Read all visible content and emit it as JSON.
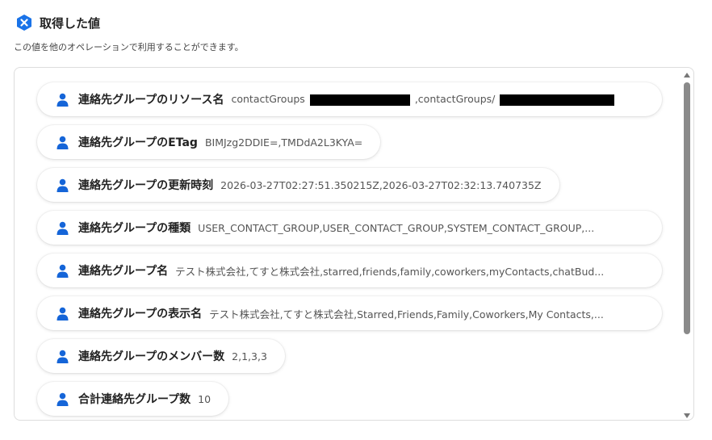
{
  "header": {
    "title": "取得した値",
    "subtitle": "この値を他のオペレーションで利用することができます。"
  },
  "colors": {
    "accent": "#1a73e8",
    "user_icon": "#1565d8"
  },
  "items": [
    {
      "label": "連絡先グループのリソース名",
      "value_pre": "contactGroups",
      "value_mid": ",contactGroups/",
      "redacted": true
    },
    {
      "label": "連絡先グループのETag",
      "value": "BIMJzg2DDIE=,TMDdA2L3KYA="
    },
    {
      "label": "連絡先グループの更新時刻",
      "value": "2026-03-27T02:27:51.350215Z,2026-03-27T02:32:13.740735Z"
    },
    {
      "label": "連絡先グループの種類",
      "value": "USER_CONTACT_GROUP,USER_CONTACT_GROUP,SYSTEM_CONTACT_GROUP,..."
    },
    {
      "label": "連絡先グループ名",
      "value": "テスト株式会社,てすと株式会社,starred,friends,family,coworkers,myContacts,chatBud..."
    },
    {
      "label": "連絡先グループの表示名",
      "value": "テスト株式会社,てすと株式会社,Starred,Friends,Family,Coworkers,My Contacts,..."
    },
    {
      "label": "連絡先グループのメンバー数",
      "value": "2,1,3,3"
    },
    {
      "label": "合計連絡先グループ数",
      "value": "10"
    }
  ]
}
